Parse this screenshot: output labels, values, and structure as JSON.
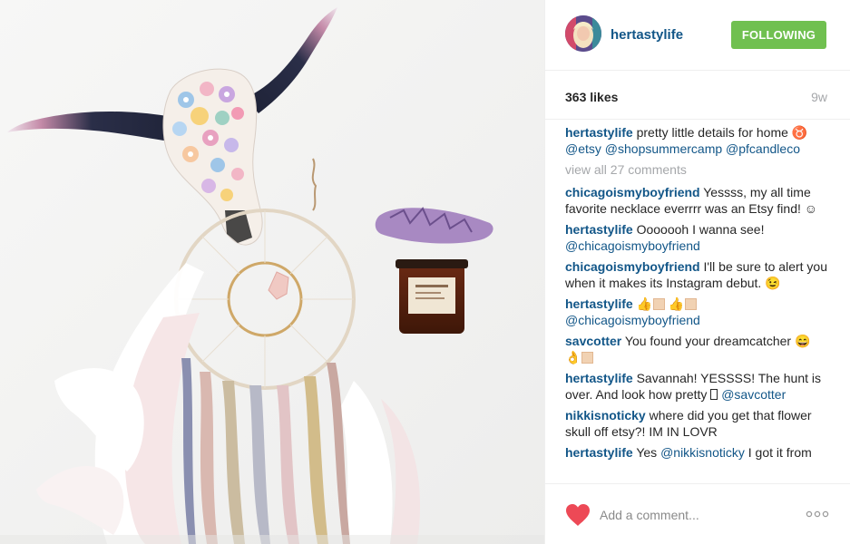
{
  "post": {
    "username": "hertastylife",
    "follow_label": "FOLLOWING",
    "likes": "363 likes",
    "age": "9w",
    "view_all": "view all 27 comments",
    "add_comment_placeholder": "Add a comment..."
  },
  "caption": {
    "username": "hertastylife",
    "text": " pretty little details for home ♉ ",
    "mentions": [
      "@etsy",
      "@shopsummercamp",
      "@pfcandleco"
    ]
  },
  "comments": [
    {
      "username": "chicagoismyboyfriend",
      "text": " Yessss, my all time favorite necklace everrrr was an Etsy find! ☺"
    },
    {
      "username": "hertastylife",
      "text": " Ooooooh I wanna see!",
      "mention": "@chicagoismyboyfriend"
    },
    {
      "username": "chicagoismyboyfriend",
      "text": " I'll be sure to alert you when it makes its Instagram debut. 😉"
    },
    {
      "username": "hertastylife",
      "text": " 👍",
      "text2": "👍",
      "mention": "@chicagoismyboyfriend"
    },
    {
      "username": "savcotter",
      "text": " You found your dreamcatcher 😄",
      "text2": "👌"
    },
    {
      "username": "hertastylife",
      "text": " Savannah! YESSSS! The hunt is over. And look how pretty ",
      "mention": "@savcotter"
    },
    {
      "username": "nikkisnoticky",
      "text": " where did you get that flower skull off etsy?! IM IN LOVR"
    },
    {
      "username": "hertastylife",
      "text": " Yes ",
      "mention": "@nikkisnoticky",
      "text2": " I got it from"
    }
  ],
  "icons": {
    "heart": "heart-icon",
    "more": "ellipsis-icon",
    "avatar": "profile-avatar"
  },
  "colors": {
    "link": "#125688",
    "follow_button": "#70c050",
    "muted": "#a5a7aa",
    "heart": "#ed4956"
  }
}
